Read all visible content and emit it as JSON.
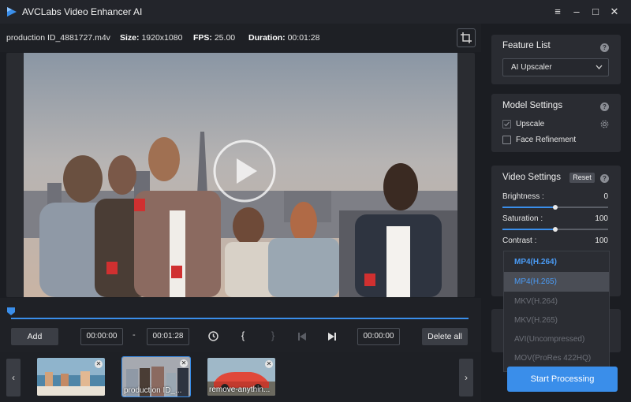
{
  "app": {
    "title": "AVCLabs Video Enhancer AI"
  },
  "window": {
    "menu": "≡",
    "minimize": "–",
    "maximize": "□",
    "close": "✕"
  },
  "info": {
    "filename": "production ID_4881727.m4v",
    "size_label": "Size:",
    "size_value": "1920x1080",
    "fps_label": "FPS:",
    "fps_value": "25.00",
    "duration_label": "Duration:",
    "duration_value": "00:01:28"
  },
  "controls": {
    "add_label": "Add",
    "start_time": "00:00:00",
    "dash": "-",
    "end_time": "00:01:28",
    "current_time": "00:00:00",
    "delete_all_label": "Delete all",
    "mark_in": "{",
    "mark_out": "}"
  },
  "thumbnails": [
    {
      "label": ""
    },
    {
      "label": "production ID_..."
    },
    {
      "label": "remove-anythin..."
    }
  ],
  "panel": {
    "feature_list": {
      "title": "Feature List",
      "selected": "AI Upscaler"
    },
    "model_settings": {
      "title": "Model Settings",
      "upscale": "Upscale",
      "face_refinement": "Face Refinement"
    },
    "video_settings": {
      "title": "Video Settings",
      "reset": "Reset",
      "brightness_label": "Brightness :",
      "brightness_value": "0",
      "brightness_level": 0.5,
      "saturation_label": "Saturation :",
      "saturation_value": "100",
      "saturation_level": 0.5,
      "contrast_label": "Contrast :",
      "contrast_value": "100"
    },
    "format_options": [
      "MP4(H.264)",
      "MP4(H.265)",
      "MKV(H.264)",
      "MKV(H.265)",
      "AVI(Uncompressed)",
      "MOV(ProRes 422HQ)"
    ],
    "start_label": "Start Processing"
  },
  "colors": {
    "accent": "#3a8eea",
    "background": "#1b1d22",
    "card": "#2a2c32"
  }
}
